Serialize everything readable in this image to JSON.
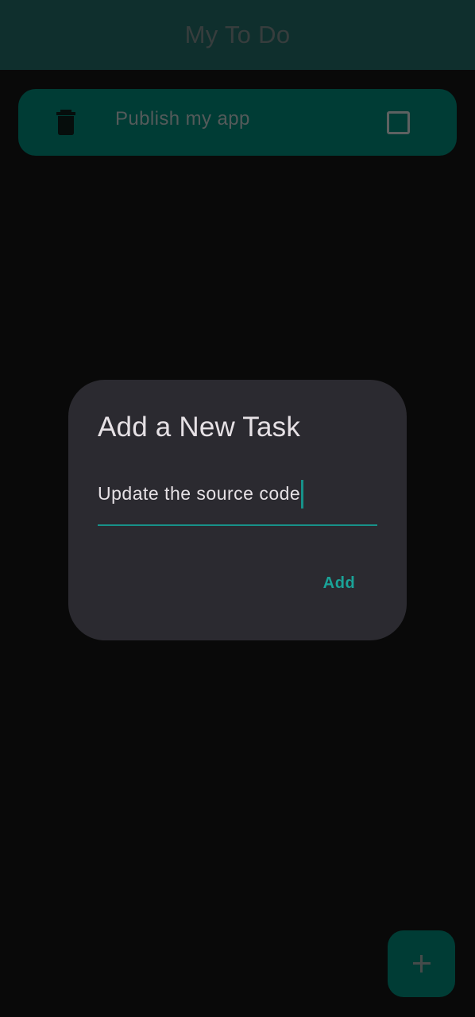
{
  "app_bar": {
    "title": "My To Do"
  },
  "tasks": [
    {
      "label": "Publish my app",
      "checked": false,
      "delete_icon": "trash-icon"
    }
  ],
  "fab": {
    "icon": "plus-icon"
  },
  "dialog": {
    "title": "Add a New Task",
    "input_value": "Update the source code",
    "add_label": "Add"
  },
  "colors": {
    "background": "#121212",
    "app_bar": "#1f5f5a",
    "card": "#00796b",
    "dialog": "#2b2a30",
    "accent": "#179189"
  }
}
